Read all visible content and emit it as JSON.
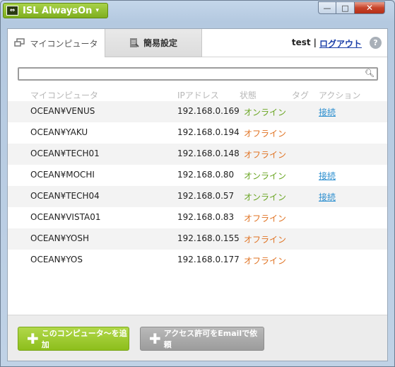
{
  "app": {
    "title": "ISL AlwaysOn",
    "title_caret": "▾"
  },
  "window_controls": {
    "minimize": "—",
    "maximize": "□",
    "close": "✕"
  },
  "tabs": [
    {
      "label": "マイコンピュータ",
      "active": true,
      "icon": "computers-icon"
    },
    {
      "label": "簡易設定",
      "active": false,
      "icon": "settings-doc-icon"
    }
  ],
  "user": {
    "name": "test",
    "separator": "|",
    "logout_label": "ログアウト",
    "help_label": "?"
  },
  "search": {
    "placeholder": "",
    "value": ""
  },
  "table": {
    "headers": {
      "name": "マイコンピュータ",
      "ip": "IPアドレス",
      "status": "状態",
      "tag": "タグ",
      "action": "アクション"
    },
    "rows": [
      {
        "name": "OCEAN¥VENUS",
        "ip": "192.168.0.169",
        "status": "オンライン",
        "online": true,
        "action": "接続"
      },
      {
        "name": "OCEAN¥YAKU",
        "ip": "192.168.0.194",
        "status": "オフライン",
        "online": false,
        "action": ""
      },
      {
        "name": "OCEAN¥TECH01",
        "ip": "192.168.0.148",
        "status": "オフライン",
        "online": false,
        "action": ""
      },
      {
        "name": "OCEAN¥MOCHI",
        "ip": "192.168.0.80",
        "status": "オンライン",
        "online": true,
        "action": "接続"
      },
      {
        "name": "OCEAN¥TECH04",
        "ip": "192.168.0.57",
        "status": "オンライン",
        "online": true,
        "action": "接続"
      },
      {
        "name": "OCEAN¥VISTA01",
        "ip": "192.168.0.83",
        "status": "オフライン",
        "online": false,
        "action": ""
      },
      {
        "name": "OCEAN¥YOSH",
        "ip": "192.168.0.155",
        "status": "オフライン",
        "online": false,
        "action": ""
      },
      {
        "name": "OCEAN¥YOS",
        "ip": "192.168.0.177",
        "status": "オフライン",
        "online": false,
        "action": ""
      }
    ]
  },
  "footer": {
    "add_button": "このコンピュータ～を追加",
    "request_button": "アクセス許可をEmailで依頼"
  },
  "colors": {
    "online": "#69a521",
    "offline": "#e07323",
    "link": "#2d8fcf",
    "brand_green": "#8dbe1c"
  }
}
